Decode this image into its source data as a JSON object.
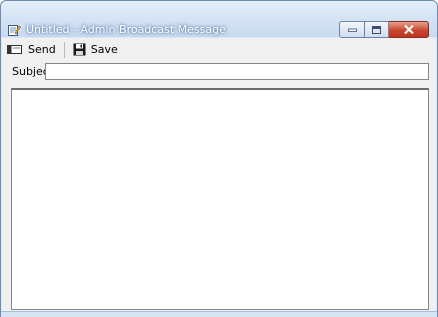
{
  "window": {
    "title": "Untitled - Admin Broadcast Message",
    "icon": "notepad-pen-icon",
    "controls": [
      "minimize-icon",
      "maximize-icon",
      "close-icon"
    ],
    "accent_close": "#c9472f"
  },
  "toolbar": {
    "send_label": "Send",
    "send_icon": "envelope-icon",
    "save_label": "Save",
    "save_icon": "floppy-disk-icon"
  },
  "subject": {
    "label": "Subject",
    "value": ""
  },
  "message": {
    "value": ""
  }
}
